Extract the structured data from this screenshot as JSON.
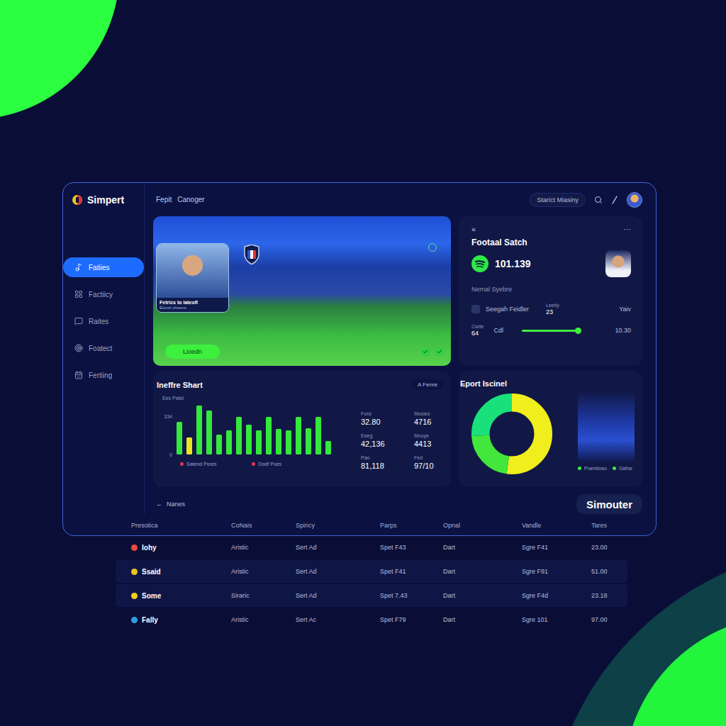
{
  "logo": {
    "text": "Simpert"
  },
  "topbar": {
    "links": [
      "Fepit",
      "Canoger"
    ],
    "search": {
      "placeholder": "Starict Miasiny"
    }
  },
  "sidebar": {
    "items": [
      {
        "label": "Fatiies",
        "selected": true
      },
      {
        "label": "Factiicy",
        "selected": false
      },
      {
        "label": "Raites",
        "selected": false
      },
      {
        "label": "Foatect",
        "selected": false
      },
      {
        "label": "Fertiing",
        "selected": false
      }
    ]
  },
  "hero": {
    "player_card": {
      "name": "Fetrics to Iateofl",
      "subtitle": "Etunsl cheens"
    },
    "button": "Lioedn"
  },
  "match_card": {
    "back": "«",
    "menu": "···",
    "title": "Footaal Satch",
    "score": "101.139",
    "section": "Nemal Syebre",
    "player": {
      "name": "Seegah Feidler",
      "stat_label": "Leeity",
      "stat_value": "23",
      "tag": "Yaiv"
    },
    "progress": {
      "label": "Cwite",
      "value": "64",
      "caption": "Cdl",
      "level": 0.94,
      "reading": "10.30"
    }
  },
  "chart": {
    "title": "Ineffre Shart",
    "tab": "A Fenre",
    "axis_label": "Ees Patid",
    "ticks": [
      "334",
      "0"
    ],
    "bars": [
      {
        "value": 285,
        "color": "#35e83c"
      },
      {
        "value": 149,
        "color": "#e8e61e"
      },
      {
        "value": 427,
        "color": "#35e83c"
      },
      {
        "value": 384,
        "color": "#35e83c"
      },
      {
        "value": 173,
        "color": "#35e83c"
      },
      {
        "value": 210,
        "color": "#35e83c"
      },
      {
        "value": 328,
        "color": "#35e83c"
      },
      {
        "value": 260,
        "color": "#35e83c"
      },
      {
        "value": 210,
        "color": "#35e83c"
      },
      {
        "value": 328,
        "color": "#35e83c"
      },
      {
        "value": 223,
        "color": "#35e83c"
      },
      {
        "value": 210,
        "color": "#35e83c"
      },
      {
        "value": 328,
        "color": "#35e83c"
      },
      {
        "value": 229,
        "color": "#35e83c"
      },
      {
        "value": 328,
        "color": "#35e83c"
      },
      {
        "value": 118,
        "color": "#35e83c"
      }
    ],
    "legend": [
      {
        "label": "Satend Pores",
        "color": "#e8344e"
      },
      {
        "label": "Dodf Poes",
        "color": "#e8344e"
      }
    ]
  },
  "stats": [
    {
      "label": "Ford",
      "value": "32.80"
    },
    {
      "label": "Mosies",
      "value": "4716"
    },
    {
      "label": "Eeeg",
      "value": "42,136"
    },
    {
      "label": "Mooye",
      "value": "4413"
    },
    {
      "label": "Pao",
      "value": "81,118"
    },
    {
      "label": "Fed",
      "value": "97/10"
    }
  ],
  "donut": {
    "title": "Eport Iscinel",
    "segments": [
      {
        "value": 52,
        "color": "#f0ee1c"
      },
      {
        "value": 22,
        "color": "#43e63c"
      },
      {
        "value": 26,
        "color": "#19e07a"
      }
    ],
    "legend": [
      {
        "label": "Poeridoeo",
        "color": "#3ee84a"
      },
      {
        "label": "Gafoe",
        "color": "#3ee84a"
      }
    ]
  },
  "footer": {
    "back_icon": "←",
    "back_link": "Nanes",
    "button": "Simouter"
  },
  "table": {
    "columns": [
      "Presotica",
      "CoNais",
      "Spiricy",
      "Parps",
      "Opnal",
      "Vandle",
      "Tares"
    ],
    "rows": [
      {
        "cells": [
          "Iohy",
          "Aristic",
          "Sert Ad",
          "Spet F43",
          "Dart",
          "Sgre F41",
          "23.00"
        ],
        "selected": false,
        "color": "#e94b3c"
      },
      {
        "cells": [
          "Ssaid",
          "Aristic",
          "Sert Ad",
          "Spet F41",
          "Dart",
          "Sgre F91",
          "51.00"
        ],
        "selected": true,
        "color": "#e8c81e"
      },
      {
        "cells": [
          "Some",
          "Siraric",
          "Sert Ad",
          "Spet 7.43",
          "Dart",
          "Sgre F4d",
          "23.18"
        ],
        "selected": true,
        "color": "#f0d020"
      },
      {
        "cells": [
          "Fally",
          "Aristic",
          "Sert Ac",
          "Spet F79",
          "Dart",
          "Sgre 101",
          "97.00"
        ],
        "selected": false,
        "color": "#2aa0e0"
      }
    ]
  }
}
